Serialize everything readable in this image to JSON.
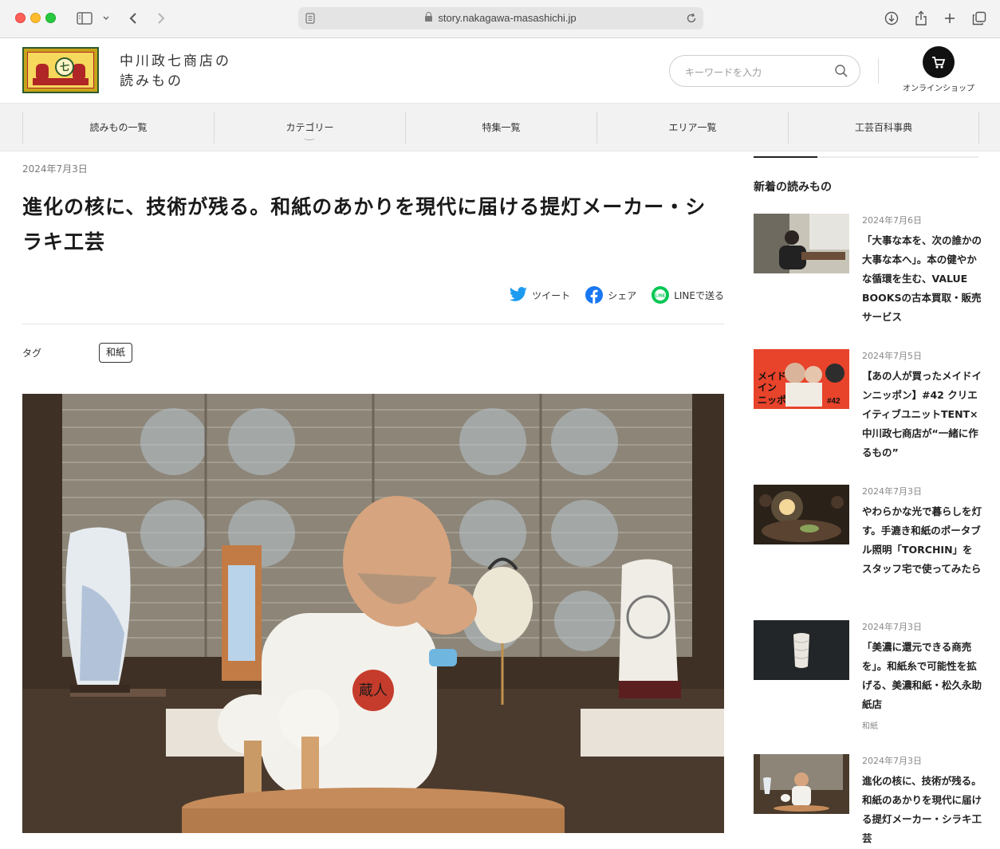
{
  "browser": {
    "url": "story.nakagawa-masashichi.jp"
  },
  "header": {
    "site_title_line1": "中川政七商店の",
    "site_title_line2": "読みもの",
    "logo_glyph": "七",
    "search_placeholder": "キーワードを入力",
    "shop_label": "オンラインショップ"
  },
  "nav": {
    "items": [
      {
        "label": "読みもの一覧"
      },
      {
        "label": "カテゴリー"
      },
      {
        "label": "特集一覧"
      },
      {
        "label": "エリア一覧"
      },
      {
        "label": "工芸百科事典"
      }
    ]
  },
  "article": {
    "date": "2024年7月3日",
    "title": "進化の核に、技術が残る。和紙のあかりを現代に届ける提灯メーカー・シラキ工芸",
    "share": {
      "tweet": "ツイート",
      "facebook": "シェア",
      "line": "LINEで送る"
    },
    "tag_label": "タグ",
    "tag": "和紙",
    "hero_shirt_text": "蔵人"
  },
  "sidebar": {
    "heading": "新着の読みもの",
    "items": [
      {
        "date": "2024年7月6日",
        "title": "「大事な本を、次の誰かの大事な本へ」。本の健やかな循環を生む、VALUE BOOKSの古本買取・販売サービス",
        "tag": ""
      },
      {
        "date": "2024年7月5日",
        "title": "【あの人が買ったメイドインニッポン】#42 クリエイティブユニットTENT×中川政七商店が“一緒に作るもの”",
        "tag": "",
        "thumb_text1": "メイド",
        "thumb_text2": "イン",
        "thumb_text3": "ニッポン",
        "thumb_num": "#42"
      },
      {
        "date": "2024年7月3日",
        "title": "やわらかな光で暮らしを灯す。手漉き和紙のポータブル照明「TORCHIN」をスタッフ宅で使ってみたら",
        "tag": ""
      },
      {
        "date": "2024年7月3日",
        "title": "「美濃に還元できる商売を」。和紙糸で可能性を拡げる、美濃和紙・松久永助紙店",
        "tag": "和紙"
      },
      {
        "date": "2024年7月3日",
        "title": "進化の核に、技術が残る。和紙のあかりを現代に届ける提灯メーカー・シラキ工芸",
        "tag": ""
      }
    ]
  },
  "colors": {
    "accent_red": "#e8432b",
    "twitter": "#1d9bf0",
    "facebook": "#1877f2",
    "line": "#06c755"
  }
}
